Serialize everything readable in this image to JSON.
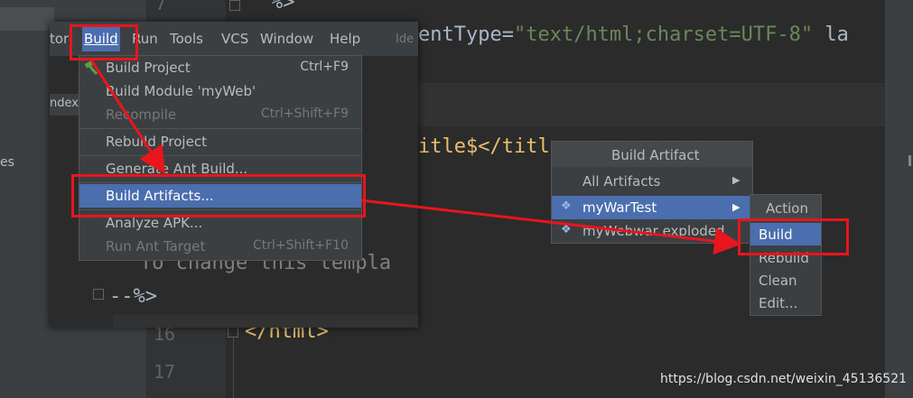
{
  "editor": {
    "line_numbers": [
      "7",
      "16",
      "17"
    ],
    "code_frag_1": "%>",
    "code_frag_2_key": "entType=",
    "code_frag_2_val": "\"text/html;charset=UTF-8\"",
    "code_frag_2_tail": " la",
    "code_frag_3_title": "itle$</titl",
    "code_frag_4_cmt": "To change this templa",
    "code_frag_5": "--%>",
    "code_frag_6": "</html>",
    "sidebar_partial": "es",
    "tab_partial": "ndex",
    "ide_partial": "Ide"
  },
  "menubar": {
    "items": [
      "tor",
      "Build",
      "Run",
      "Tools",
      "VCS",
      "Window",
      "Help"
    ]
  },
  "build_menu": {
    "items": [
      {
        "label": "Build Project",
        "shortcut": "Ctrl+F9"
      },
      {
        "label": "Build Module 'myWeb'",
        "shortcut": ""
      },
      {
        "label": "Recompile",
        "shortcut": "Ctrl+Shift+F9"
      },
      {
        "label": "Rebuild Project",
        "shortcut": ""
      },
      {
        "label": "Generate Ant Build...",
        "shortcut": ""
      },
      {
        "label": "Build Artifacts...",
        "shortcut": ""
      },
      {
        "label": "Analyze APK...",
        "shortcut": ""
      },
      {
        "label": "Run Ant Target",
        "shortcut": "Ctrl+Shift+F10"
      }
    ]
  },
  "artifact_popup": {
    "title": "Build Artifact",
    "items": [
      "All Artifacts",
      "myWarTest",
      "myWebwar exploded"
    ]
  },
  "action_popup": {
    "title": "Action",
    "items": [
      "Build",
      "Rebuild",
      "Clean",
      "Edit..."
    ]
  },
  "watermark": "https://blog.csdn.net/weixin_45136521",
  "colors": {
    "accent": "#4b6eaf",
    "annotation_red": "#e8161c"
  }
}
